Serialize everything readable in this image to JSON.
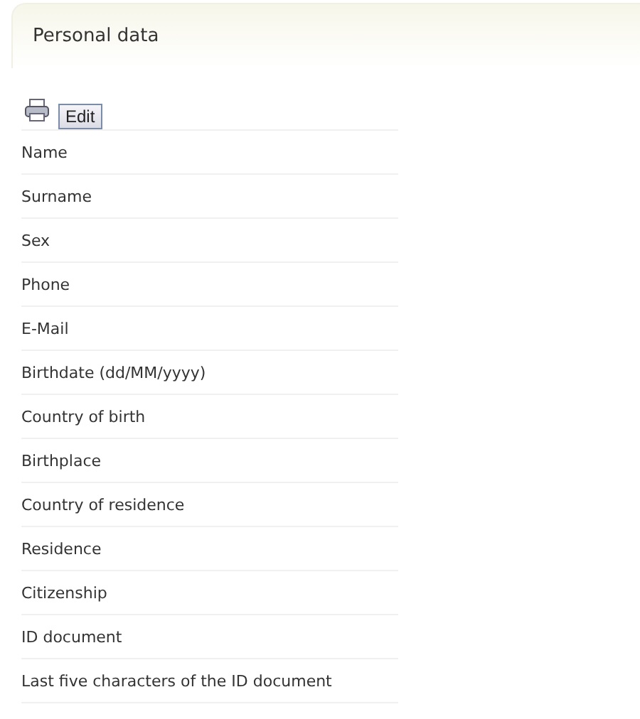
{
  "panel": {
    "title": "Personal data"
  },
  "toolbar": {
    "edit_button": "Edit"
  },
  "fields": [
    "Name",
    "Surname",
    "Sex",
    "Phone",
    "E-Mail",
    "Birthdate (dd/MM/yyyy)",
    "Country of birth",
    "Birthplace",
    "Country of residence",
    "Residence",
    "Citizenship",
    "ID document",
    "Last five characters of the ID document"
  ]
}
